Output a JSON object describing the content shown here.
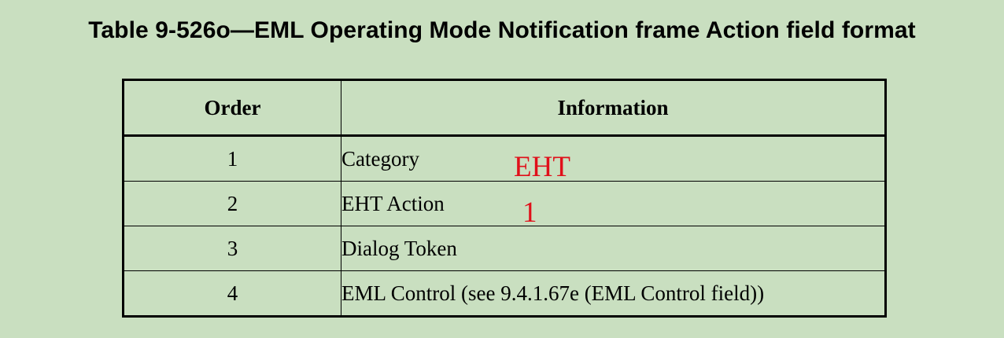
{
  "title": "Table 9-526o—EML Operating Mode Notification frame Action field format",
  "table": {
    "headers": [
      "Order",
      "Information"
    ],
    "rows": [
      {
        "order": "1",
        "information": "Category"
      },
      {
        "order": "2",
        "information": "EHT Action"
      },
      {
        "order": "3",
        "information": "Dialog Token"
      },
      {
        "order": "4",
        "information": "EML Control (see 9.4.1.67e (EML Control field))"
      }
    ]
  },
  "annotations": {
    "category_value": "EHT",
    "eht_action_value": "1",
    "color": "#e0101a"
  },
  "colors": {
    "background": "#c9dfc0",
    "text": "#000000"
  }
}
